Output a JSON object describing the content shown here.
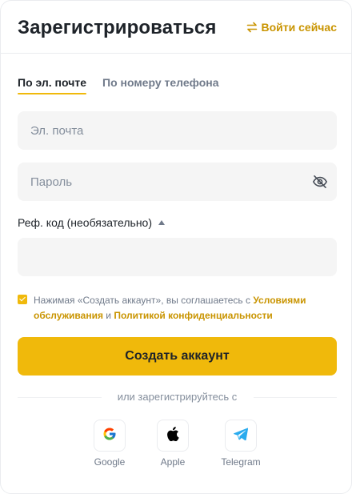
{
  "header": {
    "title": "Зарегистрироваться",
    "login_link": "Войти сейчас"
  },
  "tabs": [
    {
      "label": "По эл. почте",
      "active": true
    },
    {
      "label": "По номеру телефона",
      "active": false
    }
  ],
  "form": {
    "email_placeholder": "Эл. почта",
    "password_placeholder": "Пароль",
    "referral_label": "Реф. код (необязательно)",
    "referral_value": "",
    "agree_checked": true,
    "agree_prefix": "Нажимая «Создать аккаунт», вы соглашаетесь с ",
    "terms_link": "Условиями обслуживания",
    "agree_middle": " и ",
    "privacy_link": "Политикой конфиденциальности",
    "submit_label": "Создать аккаунт"
  },
  "social": {
    "divider_text": "или зарегистрируйтесь с",
    "providers": [
      {
        "label": "Google",
        "icon": "google-icon"
      },
      {
        "label": "Apple",
        "icon": "apple-icon"
      },
      {
        "label": "Telegram",
        "icon": "telegram-icon"
      }
    ]
  },
  "colors": {
    "accent": "#F0B90B",
    "link": "#C99400",
    "text_primary": "#1E2329",
    "text_secondary": "#707A8A",
    "input_bg": "#F5F5F5",
    "telegram": "#2AABEE"
  }
}
